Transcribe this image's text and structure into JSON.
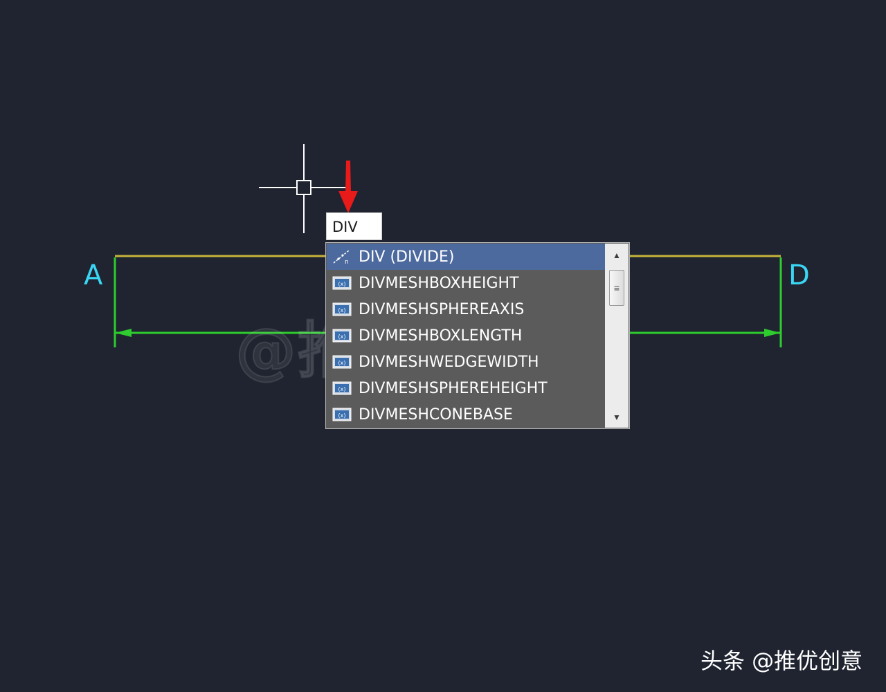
{
  "canvas": {
    "point_labels": {
      "a": "A",
      "d": "D"
    },
    "watermark": "@推优创意",
    "colors": {
      "background": "#1f2430",
      "yellow_line": "#c8b43a",
      "green_line": "#2ecc2e",
      "label_cyan": "#3ad6f4",
      "arrow_red": "#e81a1a"
    }
  },
  "command": {
    "input_value": "DIV"
  },
  "autocomplete": {
    "items": [
      {
        "label": "DIV (DIVIDE)",
        "icon": "divide-command-icon",
        "selected": true
      },
      {
        "label": "DIVMESHBOXHEIGHT",
        "icon": "system-variable-icon",
        "selected": false
      },
      {
        "label": "DIVMESHSPHEREAXIS",
        "icon": "system-variable-icon",
        "selected": false
      },
      {
        "label": "DIVMESHBOXLENGTH",
        "icon": "system-variable-icon",
        "selected": false
      },
      {
        "label": "DIVMESHWEDGEWIDTH",
        "icon": "system-variable-icon",
        "selected": false
      },
      {
        "label": "DIVMESHSPHEREHEIGHT",
        "icon": "system-variable-icon",
        "selected": false
      },
      {
        "label": "DIVMESHCONEBASE",
        "icon": "system-variable-icon",
        "selected": false
      }
    ],
    "scrollbar": {
      "up": "▲",
      "down": "▼",
      "thumb": "≡"
    }
  },
  "footer": {
    "brand": "头条 @推优创意"
  }
}
